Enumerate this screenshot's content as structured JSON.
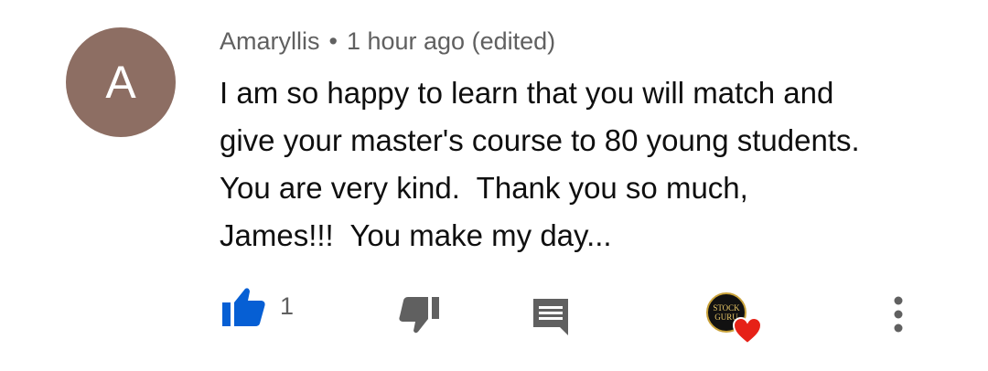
{
  "comment": {
    "avatar_letter": "A",
    "author": "Amaryllis",
    "separator": "•",
    "timestamp": "1 hour ago (edited)",
    "body_lines": [
      "I am so happy to learn that you will match and",
      "give your master's course to 80 young students.",
      "You are very kind.  Thank you so much,",
      "James!!!  You make my day..."
    ],
    "like_count": "1",
    "creator_badge": {
      "line1": "STOCK",
      "line2": "GURU"
    }
  },
  "colors": {
    "avatar_bg": "#8d6e63",
    "like_active": "#065fd4",
    "icon_gray": "#606060",
    "heart": "#e62117"
  },
  "icons": {
    "like": "thumbs-up-icon",
    "dislike": "thumbs-down-icon",
    "reply": "comment-icon",
    "heart": "heart-icon",
    "more": "more-vertical-icon"
  }
}
